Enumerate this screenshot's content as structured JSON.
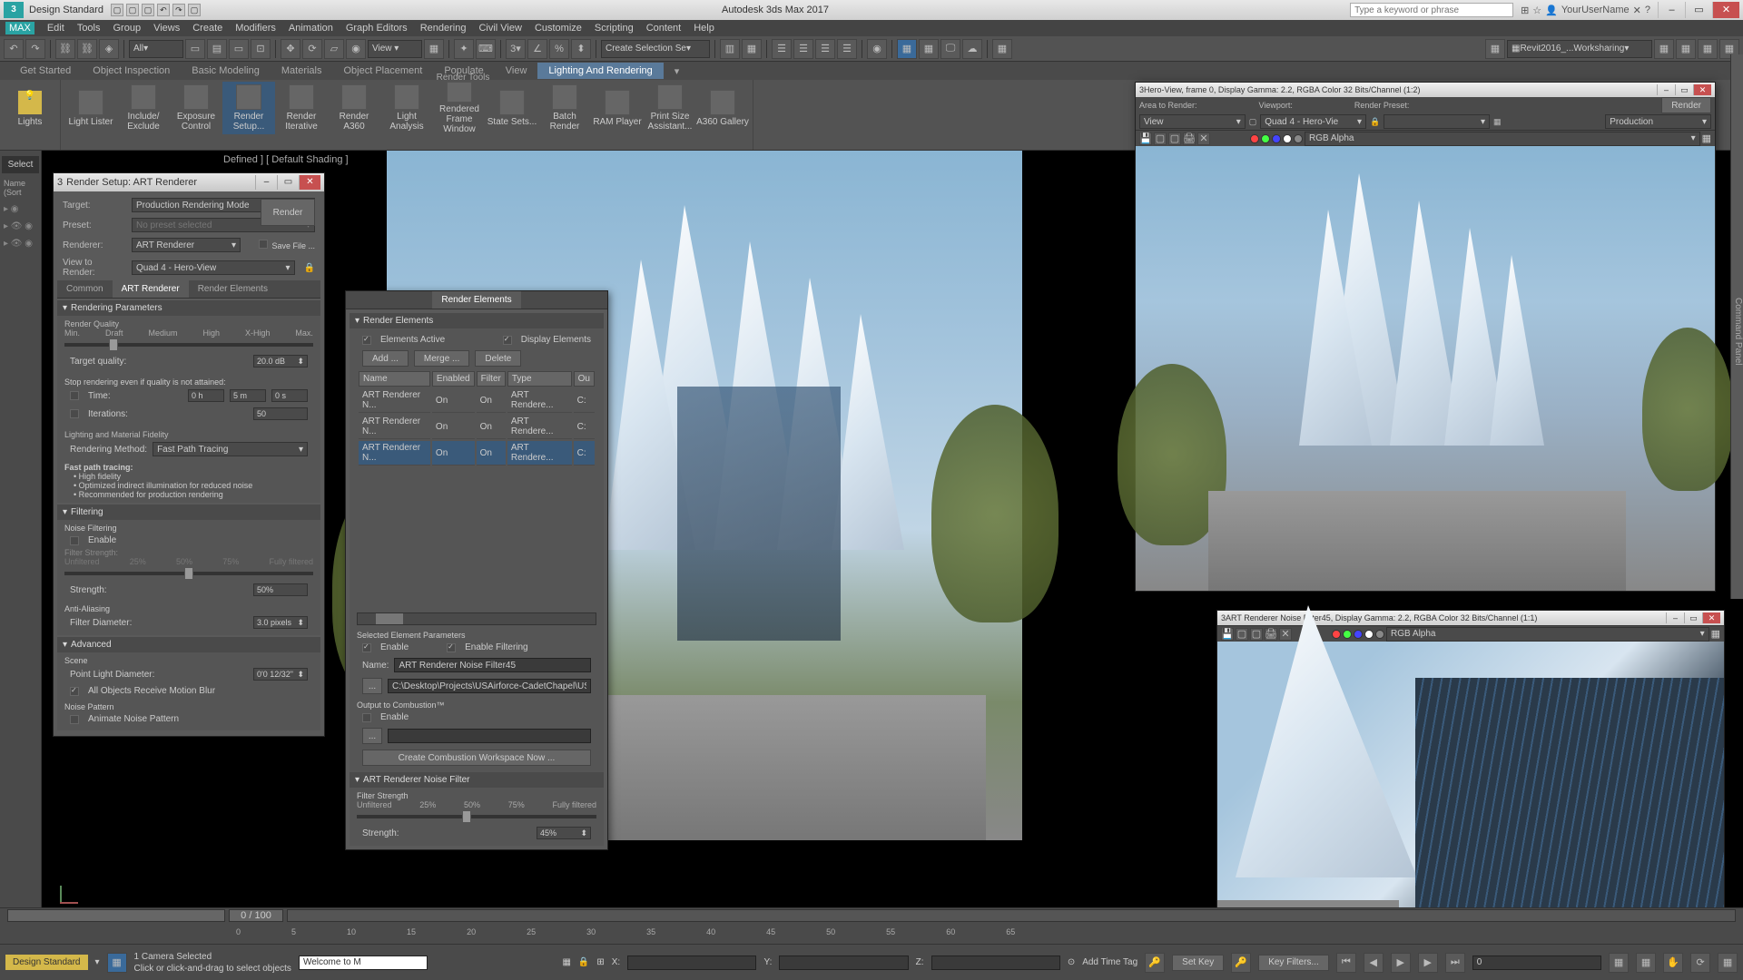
{
  "app": {
    "title": "Autodesk 3ds Max 2017",
    "workspace": "Design Standard"
  },
  "search": {
    "placeholder": "Type a keyword or phrase"
  },
  "user": {
    "name": "YourUserName"
  },
  "menu": [
    "Edit",
    "Tools",
    "Group",
    "Views",
    "Create",
    "Modifiers",
    "Animation",
    "Graph Editors",
    "Rendering",
    "Civil View",
    "Customize",
    "Scripting",
    "Content",
    "Help"
  ],
  "toolbar_dropdown": "All",
  "selection_set": "Create Selection Se",
  "quickaccess_link": "Revit2016_...Worksharing",
  "tabs": [
    "Get Started",
    "Object Inspection",
    "Basic Modeling",
    "Materials",
    "Object Placement",
    "Populate",
    "View",
    "Lighting And Rendering"
  ],
  "active_tab": "Lighting And Rendering",
  "ribbon": {
    "lights": "Lights",
    "buttons": [
      "Light\nLister",
      "Include/\nExclude",
      "Exposure\nControl",
      "Render\nSetup...",
      "Render\nIterative",
      "Render\nA360",
      "Light\nAnalysis",
      "Rendered\nFrame Window",
      "State\nSets...",
      "Batch\nRender",
      "RAM\nPlayer",
      "Print Size\nAssistant...",
      "A360\nGallery"
    ],
    "group": "Render Tools"
  },
  "left": {
    "select": "Select",
    "name": "Name (Sort"
  },
  "viewport_label": "Defined ] [ Default Shading ]",
  "render_setup": {
    "title": "Render Setup: ART Renderer",
    "target_label": "Target:",
    "target": "Production Rendering Mode",
    "preset_label": "Preset:",
    "preset": "No preset selected",
    "renderer_label": "Renderer:",
    "renderer": "ART Renderer",
    "view_label": "View to\nRender:",
    "view": "Quad 4 - Hero-View",
    "render_btn": "Render",
    "save_btn": "Save File ...",
    "tabs": [
      "Common",
      "ART Renderer",
      "Render Elements"
    ],
    "rp_head": "Rendering Parameters",
    "rq": "Render Quality",
    "q_lbls": [
      "Min.",
      "Draft",
      "Medium",
      "High",
      "X-High",
      "Max."
    ],
    "tq_label": "Target quality:",
    "tq": "20.0 dB",
    "stop": "Stop rendering even if quality is not attained:",
    "time_label": "Time:",
    "time_h": "0 h",
    "time_m": "5 m",
    "time_s": "0 s",
    "iter_label": "Iterations:",
    "iter": "50",
    "lmf": "Lighting and Material Fidelity",
    "rm_label": "Rendering Method:",
    "rm": "Fast Path Tracing",
    "fpt": "Fast path tracing:",
    "fpt1": "High fidelity",
    "fpt2": "Optimized indirect illumination for reduced noise",
    "fpt3": "Recommended for production rendering",
    "filt_head": "Filtering",
    "nf": "Noise Filtering",
    "enable": "Enable",
    "fs": "Filter Strength:",
    "fs_lbls": [
      "Unfiltered",
      "25%",
      "50%",
      "75%",
      "Fully filtered"
    ],
    "strength": "Strength:",
    "strength_v": "50%",
    "aa": "Anti-Aliasing",
    "fd_label": "Filter Diameter:",
    "fd": "3.0 pixels",
    "adv_head": "Advanced",
    "scene": "Scene",
    "pld_label": "Point Light Diameter:",
    "pld": "0'0 12/32\"",
    "mblur": "All Objects Receive Motion Blur",
    "np": "Noise Pattern",
    "anp": "Animate Noise Pattern"
  },
  "render_elements": {
    "tab": "Render Elements",
    "head": "Render Elements",
    "ea": "Elements Active",
    "de": "Display Elements",
    "add": "Add ...",
    "merge": "Merge ...",
    "delete": "Delete",
    "cols": [
      "Name",
      "Enabled",
      "Filter",
      "Type",
      "Ou"
    ],
    "rows": [
      {
        "n": "ART Renderer N...",
        "e": "On",
        "f": "On",
        "t": "ART Rendere...",
        "o": "C:"
      },
      {
        "n": "ART Renderer N...",
        "e": "On",
        "f": "On",
        "t": "ART Rendere...",
        "o": "C:"
      },
      {
        "n": "ART Renderer N...",
        "e": "On",
        "f": "On",
        "t": "ART Rendere...",
        "o": "C:"
      }
    ],
    "sep": "Selected Element Parameters",
    "en": "Enable",
    "ef": "Enable Filtering",
    "name_label": "Name:",
    "name_v": "ART Renderer Noise Filter45",
    "path": "C:\\Desktop\\Projects\\USAirforce-CadetChapel\\USA",
    "oc": "Output to Combustion™",
    "oc_en": "Enable",
    "ccw": "Create Combustion Workspace Now ...",
    "arnf": "ART Renderer Noise Filter",
    "fs2": "Filter Strength",
    "fs2_lbls": [
      "Unfiltered",
      "25%",
      "50%",
      "75%",
      "Fully filtered"
    ],
    "str2": "Strength:",
    "str2_v": "45%"
  },
  "frame1": {
    "title": "Hero-View, frame 0, Display Gamma: 2.2, RGBA Color 32 Bits/Channel (1:2)",
    "atr": "Area to Render:",
    "vp": "Viewport:",
    "rp": "Render Preset:",
    "view_sel": "View",
    "quad": "Quad 4 - Hero-Vie",
    "render": "Render",
    "prod": "Production",
    "alpha": "RGB Alpha"
  },
  "frame2": {
    "title": "ART Renderer Noise Filter45, Display Gamma: 2.2, RGBA Color 32 Bits/Channel (1:1)",
    "alpha": "RGB Alpha"
  },
  "timeline": {
    "frame": "0 / 100",
    "marks": [
      0,
      5,
      10,
      15,
      20,
      25,
      30,
      35,
      40,
      45,
      50,
      55,
      60,
      65
    ]
  },
  "status": {
    "sel": "1 Camera Selected",
    "hint": "Click or click-and-drag to select objects",
    "welcome": "Welcome to M",
    "x": "X:",
    "y": "Y:",
    "z": "Z:",
    "att": "Add Time Tag",
    "setkey": "Set Key",
    "keyfilters": "Key Filters..."
  },
  "cmdpanel": "Command Panel"
}
